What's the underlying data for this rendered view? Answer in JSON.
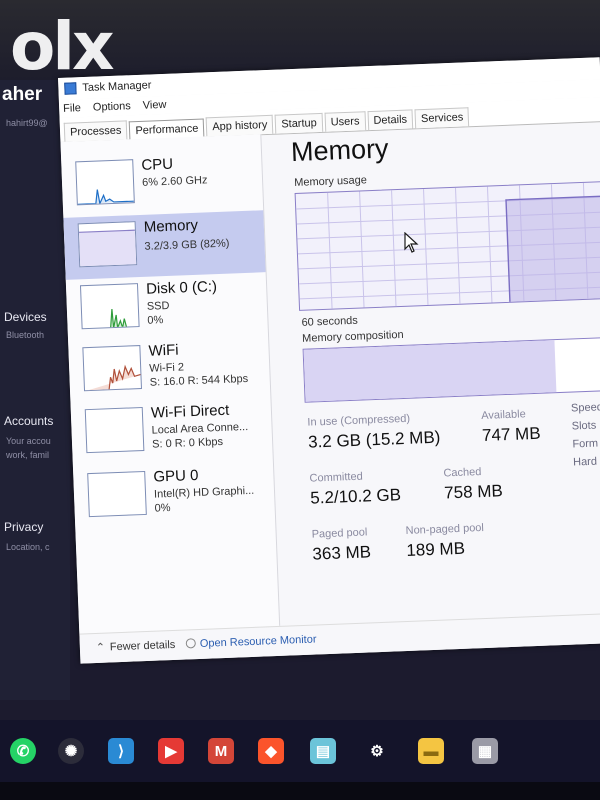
{
  "watermark": {
    "text": "olx"
  },
  "background_settings": {
    "partial_title": "aher",
    "partial_sub": "hahirt99@",
    "devices": {
      "label": "Devices",
      "sub": "Bluetooth"
    },
    "accounts": {
      "label": "Accounts",
      "sub1": "Your accou",
      "sub2": "work, famil"
    },
    "privacy": {
      "label": "Privacy",
      "sub": "Location, c"
    }
  },
  "window": {
    "title": "Task Manager",
    "menu": [
      "File",
      "Options",
      "View"
    ],
    "tabs": [
      "Processes",
      "Performance",
      "App history",
      "Startup",
      "Users",
      "Details",
      "Services"
    ],
    "active_tab": "Performance"
  },
  "resources": [
    {
      "name": "CPU",
      "line1": "6% 2.60 GHz",
      "line2": "",
      "line3": ""
    },
    {
      "name": "Memory",
      "line1": "3.2/3.9 GB (82%)",
      "line2": "",
      "line3": ""
    },
    {
      "name": "Disk 0 (C:)",
      "line1": "SSD",
      "line2": "0%",
      "line3": ""
    },
    {
      "name": "WiFi",
      "line1": "Wi-Fi 2",
      "line2": "S: 16.0 R: 544 Kbps",
      "line3": ""
    },
    {
      "name": "Wi-Fi Direct",
      "line1": "Local Area Conne...",
      "line2": "S: 0 R: 0 Kbps",
      "line3": ""
    },
    {
      "name": "GPU 0",
      "line1": "Intel(R) HD Graphi...",
      "line2": "0%",
      "line3": ""
    }
  ],
  "selected_resource": "Memory",
  "memory": {
    "title": "Memory",
    "usage_label": "Memory usage",
    "seconds_label": "60 seconds",
    "composition_label": "Memory composition",
    "composition_in_use_fraction": 0.82,
    "stats": {
      "in_use_label": "In use (Compressed)",
      "in_use_value": "3.2 GB (15.2 MB)",
      "available_label": "Available",
      "available_value": "747 MB",
      "committed_label": "Committed",
      "committed_value": "5.2/10.2 GB",
      "cached_label": "Cached",
      "cached_value": "758 MB",
      "paged_label": "Paged pool",
      "paged_value": "363 MB",
      "nonpaged_label": "Non-paged pool",
      "nonpaged_value": "189 MB"
    },
    "right_col": [
      "Speed",
      "Slots",
      "Form",
      "Hard"
    ]
  },
  "footer": {
    "fewer_details": "Fewer details",
    "open_monitor": "Open Resource Monitor"
  },
  "taskbar": {
    "icons": [
      "whatsapp-icon",
      "chatgpt-icon",
      "vscode-icon",
      "youtube-icon",
      "gmail-icon",
      "brave-icon",
      "notes-icon",
      "settings-icon",
      "file-explorer-icon",
      "app-icon"
    ],
    "colors": {
      "whatsapp": "#25d366",
      "vscode": "#2a8ad4",
      "youtube": "#e53935",
      "gmail": "#d44638",
      "brave": "#fb542b",
      "notes": "#6bc4d9",
      "explorer": "#f4c542"
    }
  },
  "colors": {
    "selected_item": "#c5cbef",
    "memory_accent": "#8a7fc7",
    "cpu_line": "#1e6fc7",
    "disk_line": "#2e9c3a",
    "wifi_line": "#b0503a"
  }
}
